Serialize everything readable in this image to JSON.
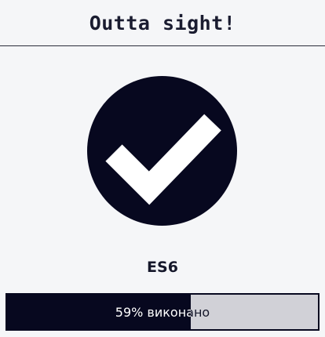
{
  "header": {
    "title": "Outta sight!"
  },
  "badge": {
    "icon": "checkmark-icon",
    "circle_color": "#07081f",
    "check_color": "#ffffff"
  },
  "lesson": {
    "name": "ES6"
  },
  "progress": {
    "percent": 59,
    "label": "59% виконано",
    "fill_color": "#07081f",
    "track_color": "#d1d1d7"
  }
}
